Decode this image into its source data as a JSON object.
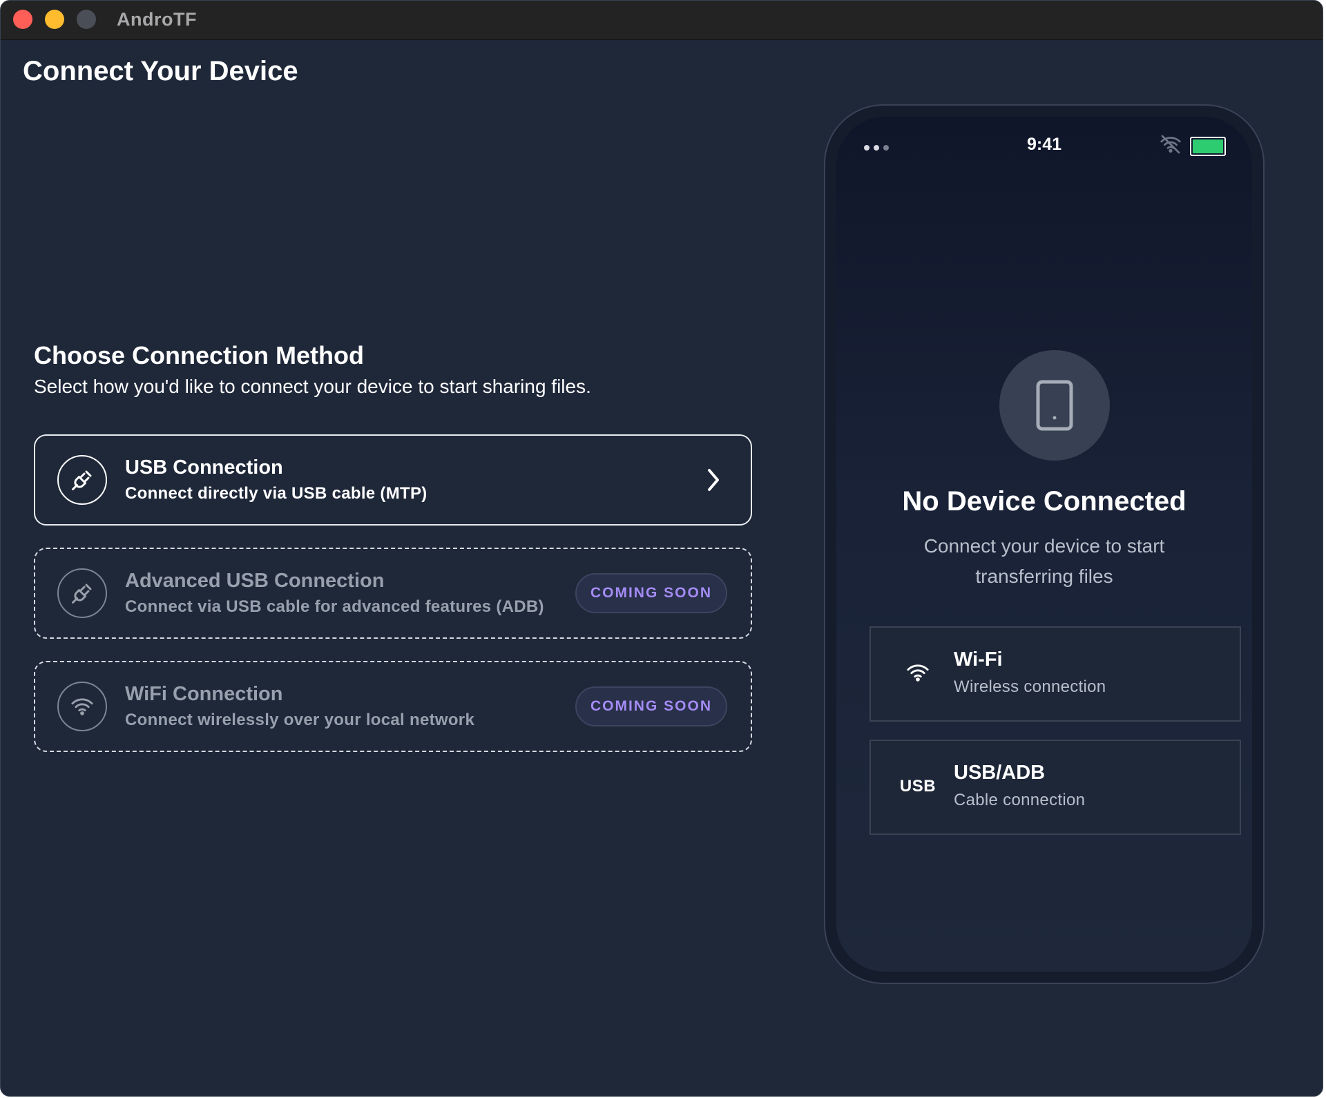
{
  "window": {
    "title": "AndroTF"
  },
  "page": {
    "title": "Connect Your Device"
  },
  "section": {
    "title": "Choose Connection Method",
    "subtitle": "Select how you'd like to connect your device to start sharing files."
  },
  "methods": [
    {
      "title": "USB Connection",
      "description": "Connect directly via USB cable (MTP)",
      "icon": "usb-plug-icon",
      "state": "available"
    },
    {
      "title": "Advanced USB Connection",
      "description": "Connect via USB cable for advanced features (ADB)",
      "icon": "usb-plug-icon",
      "state": "coming-soon",
      "badge": "COMING SOON"
    },
    {
      "title": "WiFi Connection",
      "description": "Connect wirelessly over your local network",
      "icon": "wifi-icon",
      "state": "coming-soon",
      "badge": "COMING SOON"
    }
  ],
  "phone": {
    "status_time": "9:41",
    "status_icons": [
      "signal-dots-icon",
      "wifi-off-icon",
      "battery-icon"
    ],
    "title": "No Device Connected",
    "subtitle": "Connect your device to start transferring files",
    "options": [
      {
        "title": "Wi-Fi",
        "description": "Wireless connection",
        "icon": "wifi-icon"
      },
      {
        "title": "USB/ADB",
        "description": "Cable connection",
        "icon_label": "USB"
      }
    ]
  },
  "colors": {
    "background": "#1f2839",
    "badge_text": "#a58cf5",
    "battery": "#2ecc71"
  }
}
